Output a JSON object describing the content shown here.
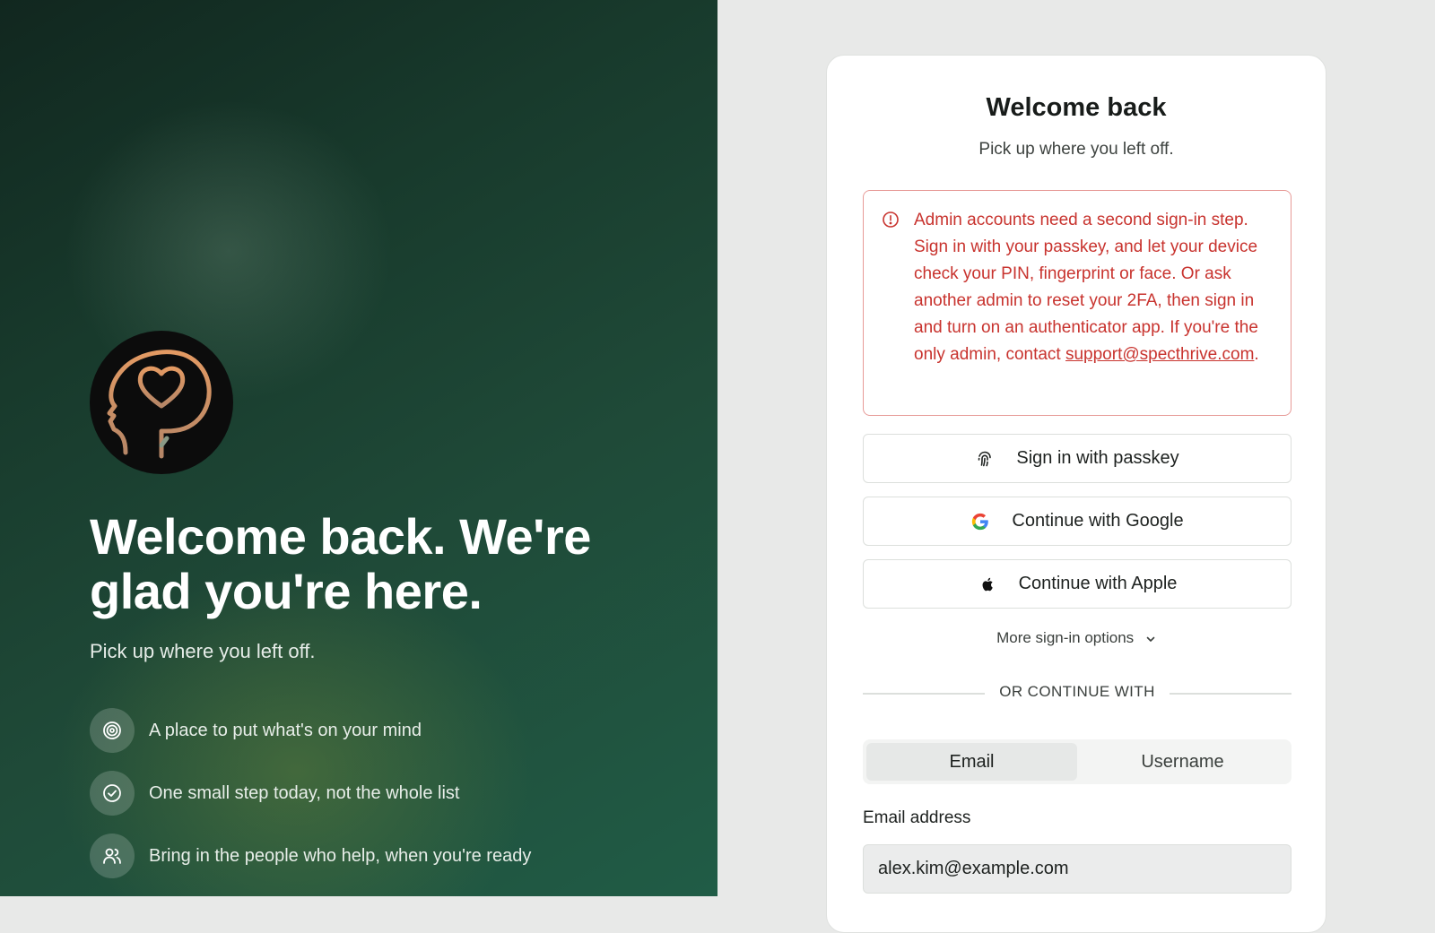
{
  "brand": {
    "logo_icon": "head-heart-icon",
    "hero_title": "Welcome back. We're glad you're here.",
    "hero_subtitle": "Pick up where you left off.",
    "features": [
      {
        "icon": "target-icon",
        "text": "A place to put what's on your mind"
      },
      {
        "icon": "check-circle-icon",
        "text": "One small step today, not the whole list"
      },
      {
        "icon": "users-icon",
        "text": "Bring in the people who help, when you're ready"
      }
    ]
  },
  "signin": {
    "title": "Welcome back",
    "subtitle": "Pick up where you left off.",
    "alert": {
      "icon": "alert-circle-icon",
      "text": "Admin accounts need a second sign-in step. Sign in with your passkey, and let your device check your PIN, fingerprint or face. Or ask another admin to reset your 2FA, then sign in and turn on an authenticator app. If you're the only admin, contact ",
      "link_text": "support@specthrive.com",
      "suffix": "."
    },
    "buttons": {
      "passkey": "Sign in with passkey",
      "google": "Continue with Google",
      "apple": "Continue with Apple"
    },
    "more_options": "More sign-in options",
    "divider_text": "OR CONTINUE WITH",
    "tabs": {
      "email": "Email",
      "username": "Username",
      "active": "email"
    },
    "email_label": "Email address",
    "email_value": "alex.kim@example.com"
  },
  "colors": {
    "brand_dark_green": "#183a2c",
    "error_red": "#c8332e",
    "logo_copper": "#d9905f"
  }
}
